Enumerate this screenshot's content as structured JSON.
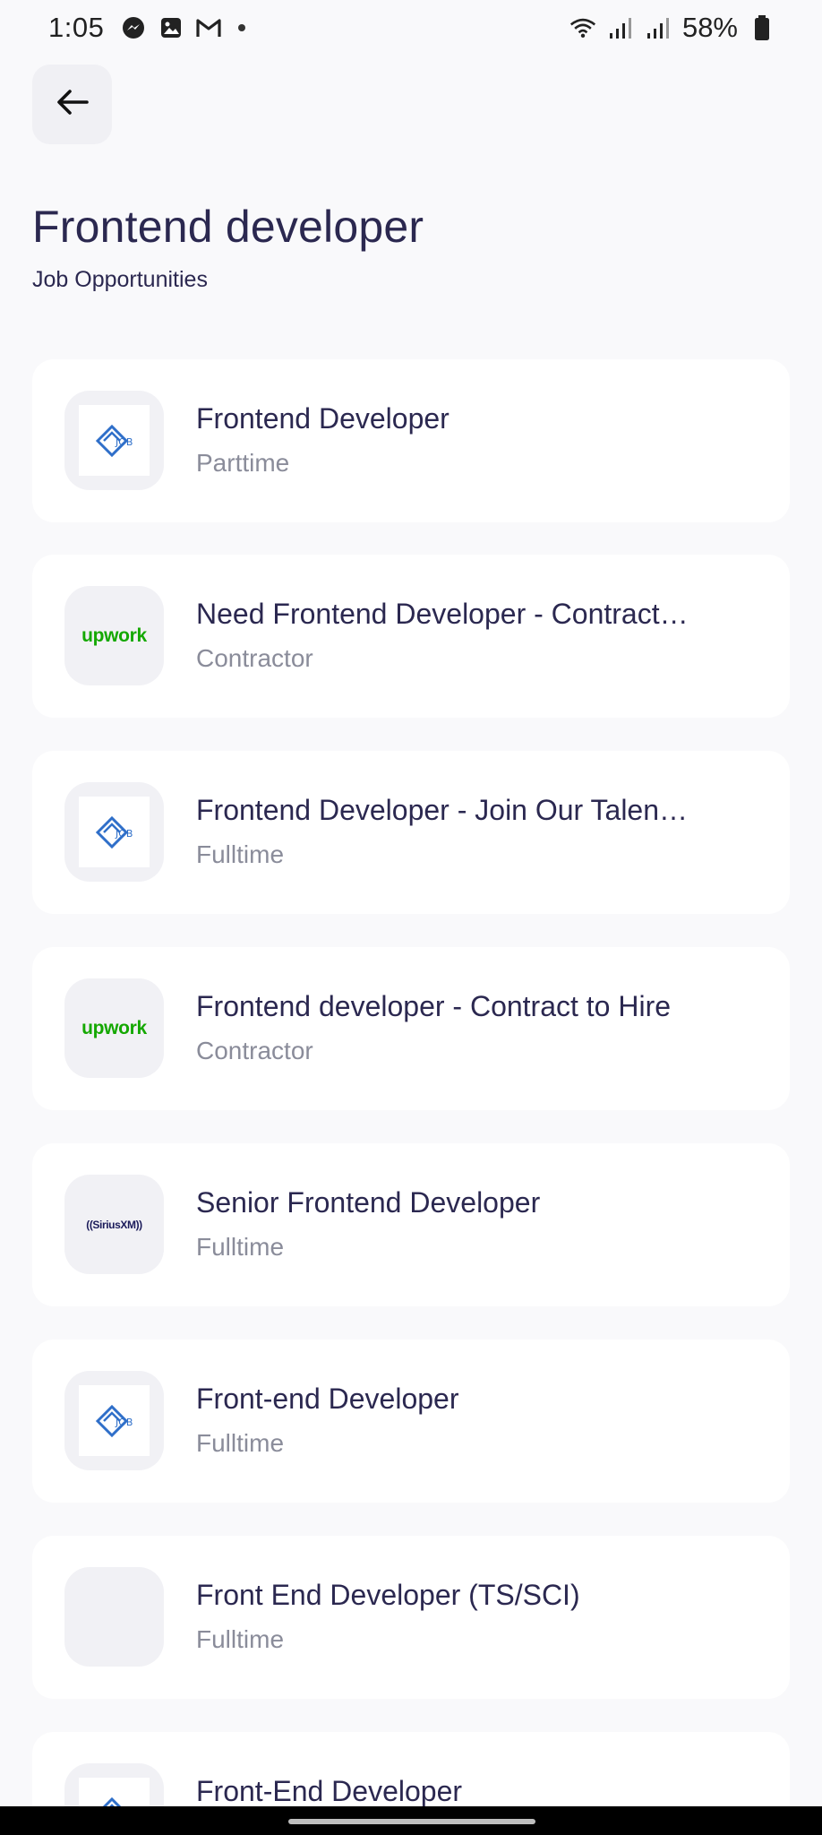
{
  "status_bar": {
    "time": "1:05",
    "battery": "58%",
    "icons": [
      "messenger-icon",
      "gallery-icon",
      "gmail-icon",
      "wifi-icon",
      "signal-icon",
      "signal-icon",
      "battery-icon"
    ]
  },
  "header": {
    "title": "Frontend developer",
    "subtitle": "Job Opportunities"
  },
  "logos": {
    "upwork": "upwork",
    "siriusxm": "((SiriusXM))"
  },
  "jobs": [
    {
      "title": "Frontend Developer",
      "type": "Parttime",
      "logo": "job-logo"
    },
    {
      "title": "Need Frontend Developer - Contract…",
      "type": "Contractor",
      "logo": "upwork-logo"
    },
    {
      "title": "Frontend Developer - Join Our Talen…",
      "type": "Fulltime",
      "logo": "job-logo"
    },
    {
      "title": "Frontend developer - Contract to Hire",
      "type": "Contractor",
      "logo": "upwork-logo"
    },
    {
      "title": "Senior Frontend Developer",
      "type": "Fulltime",
      "logo": "siriusxm-logo"
    },
    {
      "title": "Front-end Developer",
      "type": "Fulltime",
      "logo": "job-logo"
    },
    {
      "title": "Front End Developer (TS/SCI)",
      "type": "Fulltime",
      "logo": "none"
    },
    {
      "title": "Front-End Developer",
      "type": "",
      "logo": "job-logo"
    }
  ],
  "colors": {
    "background": "#f9f9fb",
    "card": "#ffffff",
    "title_text": "#2b2850",
    "secondary_text": "#8a8c9a",
    "upwork_green": "#14a800",
    "job_logo_blue": "#2f6fc9"
  }
}
